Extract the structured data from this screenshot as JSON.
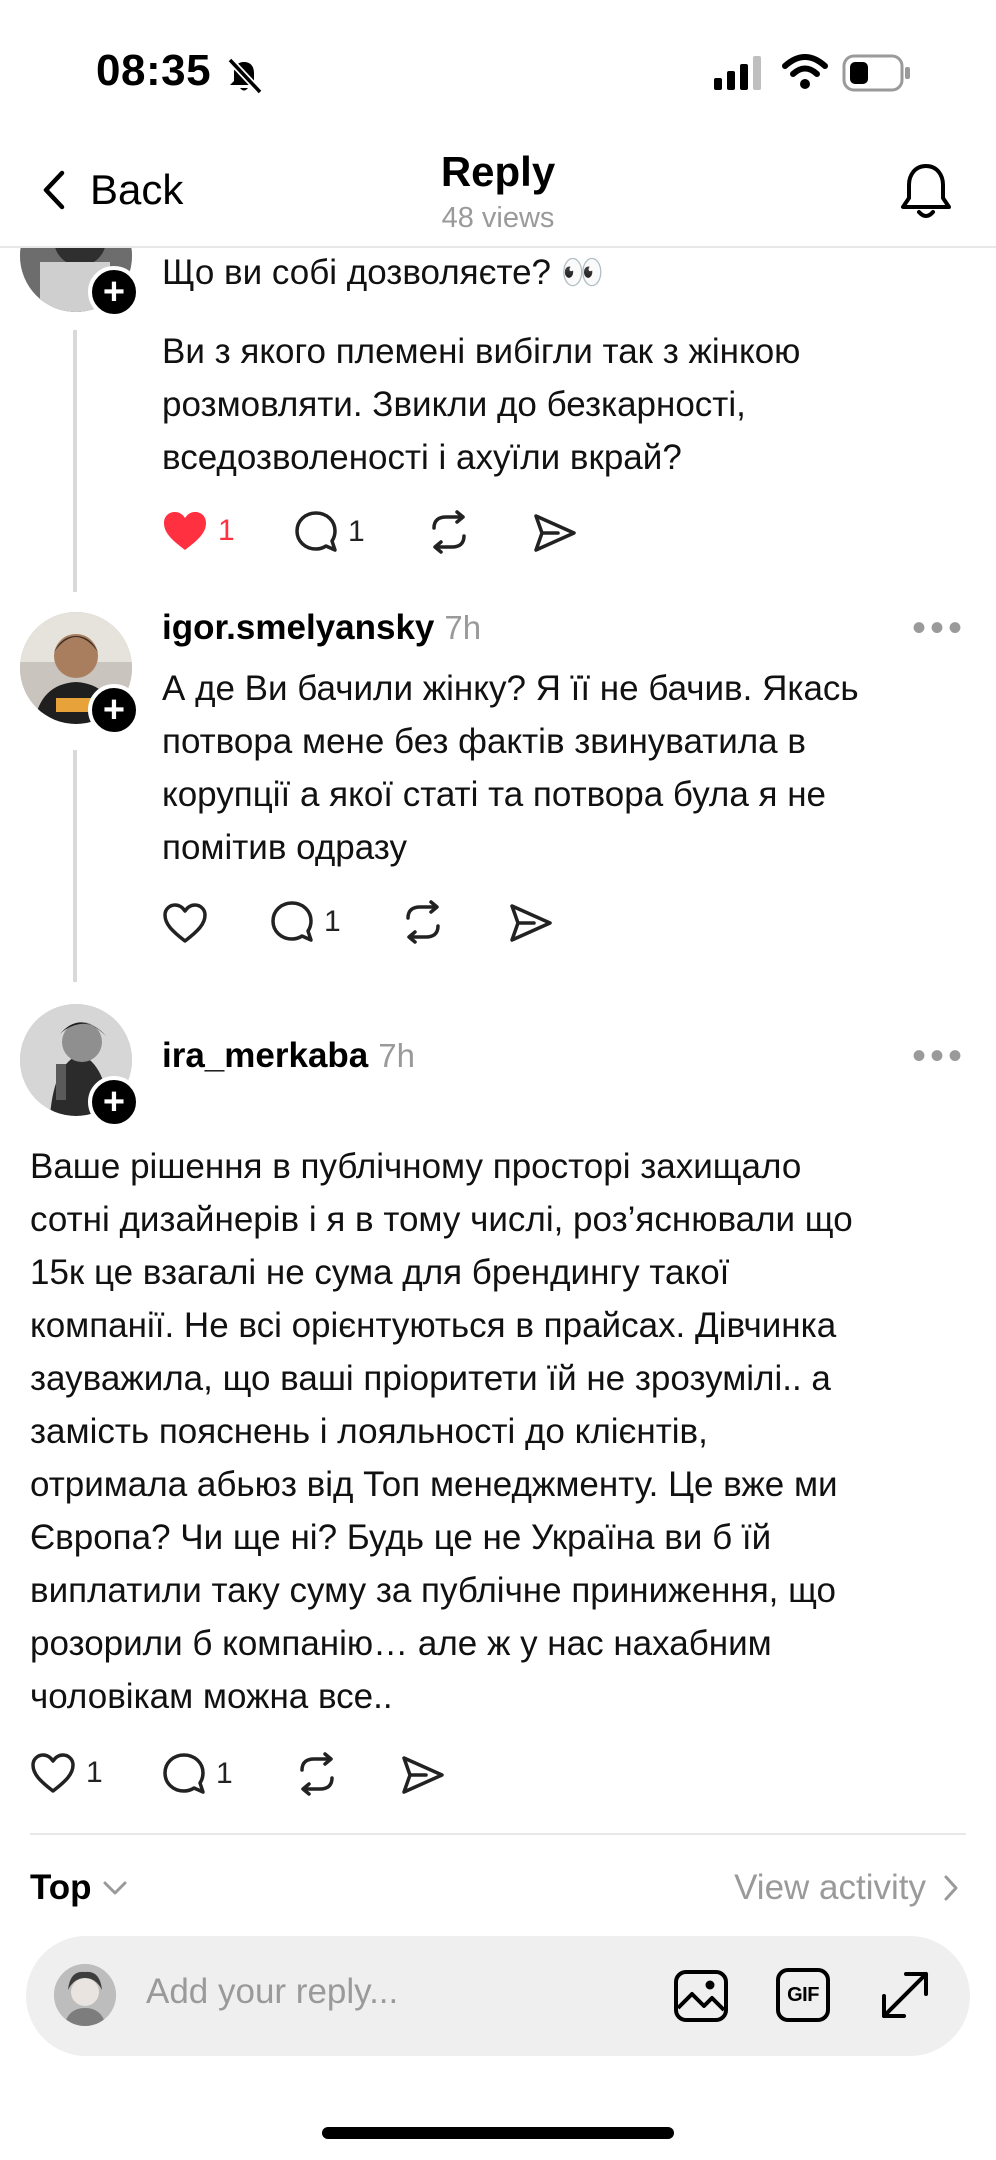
{
  "status_bar": {
    "time": "08:35"
  },
  "nav": {
    "back_label": "Back",
    "title": "Reply",
    "views": "48 views"
  },
  "posts": [
    {
      "text_lines": [
        "Що ви собі дозволяєте? 👀"
      ],
      "body_lines": [
        "Ви з якого племені вибігли так з жінкою",
        "розмовляти. Звикли до безкарності,",
        "вседозволеності і ахуїли вкрай?"
      ],
      "likes": "1",
      "replies": "1",
      "liked": true
    },
    {
      "username": "igor.smelyansky",
      "age": "7h",
      "body_lines": [
        "А де Ви бачили жінку? Я її не бачив. Якась",
        "потвора мене без фактів звинуватила в",
        "корупції а якої статі та потвора була я не",
        "помітив одразу"
      ],
      "replies": "1"
    },
    {
      "username": "ira_merkaba",
      "age": "7h",
      "body_lines": [
        "Ваше рішення в публічному просторі захищало",
        "сотні дизайнерів і я в тому числі, роз’яснювали що",
        "15к це взагалі не сума для брендингу такої",
        "компанії. Не всі орієнтуються в прайсах. Дівчинка",
        "зауважила, що ваші пріоритети їй не зрозумілі.. а",
        "замість пояснень і лояльності до клієнтів,",
        "отримала абьюз від Топ менеджменту. Це вже ми",
        "Європа? Чи ще ні? Будь це не Україна ви б їй",
        "виплатили таку суму за публічне приниження, що",
        "розорили б компанію… але ж у нас нахабним",
        "чоловікам можна все.."
      ],
      "likes": "1",
      "replies": "1"
    }
  ],
  "footer": {
    "sort_label": "Top",
    "view_activity": "View activity"
  },
  "reply_bar": {
    "placeholder": "Add your reply...",
    "gif_label": "GIF"
  },
  "colors": {
    "like_red": "#ff3040",
    "muted": "#9a9a9a"
  }
}
